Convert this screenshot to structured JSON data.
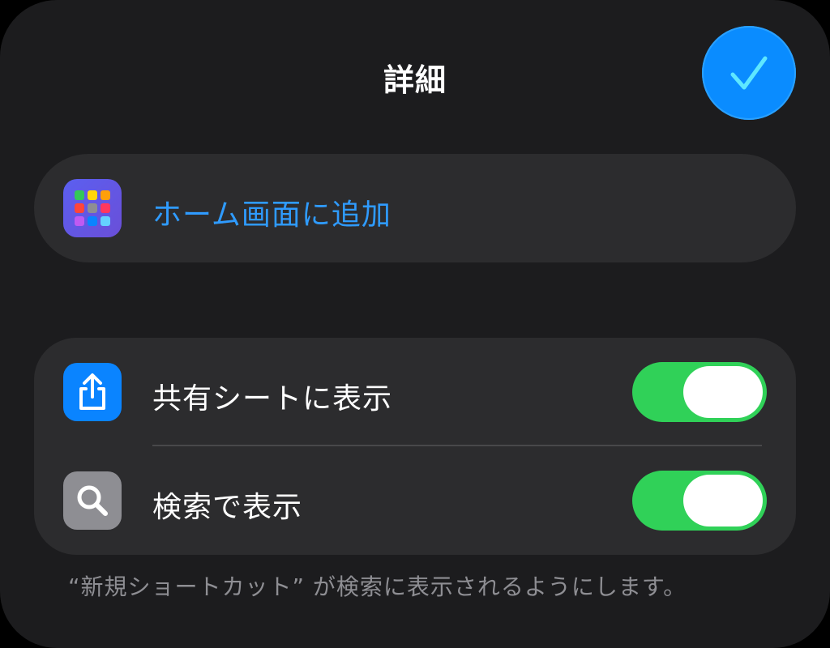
{
  "header": {
    "title": "詳細",
    "done_icon": "checkmark-icon"
  },
  "home_screen": {
    "label": "ホーム画面に追加",
    "icon": "app-grid-icon",
    "accent": "#2f9bff"
  },
  "options": [
    {
      "label": "共有シートに表示",
      "icon": "share-icon",
      "icon_bg": "#0a84ff",
      "enabled": true
    },
    {
      "label": "検索で表示",
      "icon": "magnifier-icon",
      "icon_bg": "#8e8e93",
      "enabled": true
    }
  ],
  "footnote": "“新規ショートカット” が検索に表示されるようにします。",
  "colors": {
    "sheet_bg": "#1c1c1e",
    "group_bg": "#2c2c2e",
    "toggle_on": "#30d158",
    "done_button": "#0a8cff"
  }
}
